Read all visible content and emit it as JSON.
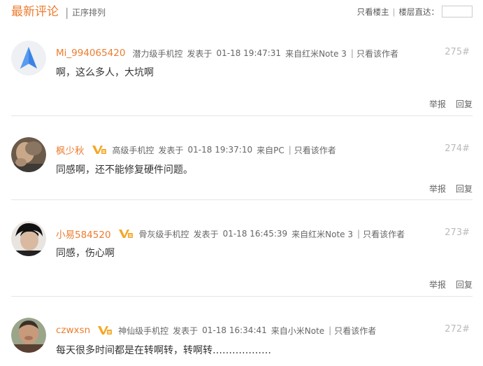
{
  "header": {
    "title": "最新评论",
    "separator": "|",
    "sort_label": "正序排列",
    "only_owner": "只看楼主",
    "divider": "|",
    "jump_label": "楼层直达：",
    "jump_value": ""
  },
  "comments": [
    {
      "username": "Mi_994065420",
      "level": "潜力级手机控",
      "posted_label": "发表于",
      "time": "01-18 19:47:31",
      "source": "来自红米Note 3",
      "sep": "|",
      "only_author": "只看该作者",
      "floor": "275#",
      "content": "啊，这么多人，大坑啊",
      "report": "举报",
      "reply": "回复"
    },
    {
      "username": "枫少秋",
      "level": "高级手机控",
      "posted_label": "发表于",
      "time": "01-18 19:37:10",
      "source": "来自PC",
      "sep": "|",
      "only_author": "只看该作者",
      "floor": "274#",
      "content": "同感啊，还不能修复硬件问题。",
      "report": "举报",
      "reply": "回复"
    },
    {
      "username": "小易584520",
      "level": "骨灰级手机控",
      "posted_label": "发表于",
      "time": "01-18 16:45:39",
      "source": "来自红米Note 3",
      "sep": "|",
      "only_author": "只看该作者",
      "floor": "273#",
      "content": "同感，伤心啊",
      "report": "举报",
      "reply": "回复"
    },
    {
      "username": "czwxsn",
      "level": "神仙级手机控",
      "posted_label": "发表于",
      "time": "01-18 16:34:41",
      "source": "来自小米Note",
      "sep": "|",
      "only_author": "只看该作者",
      "floor": "272#",
      "content": "每天很多时间都是在转啊转，转啊转………………"
    }
  ],
  "colors": {
    "accent": "#ec7c2f",
    "vip_badge": "#f5a623",
    "floor": "#bbbbbb"
  },
  "icons": {
    "vip": "vip-badge-icon",
    "nav_avatar": "navigation-arrow-icon"
  }
}
